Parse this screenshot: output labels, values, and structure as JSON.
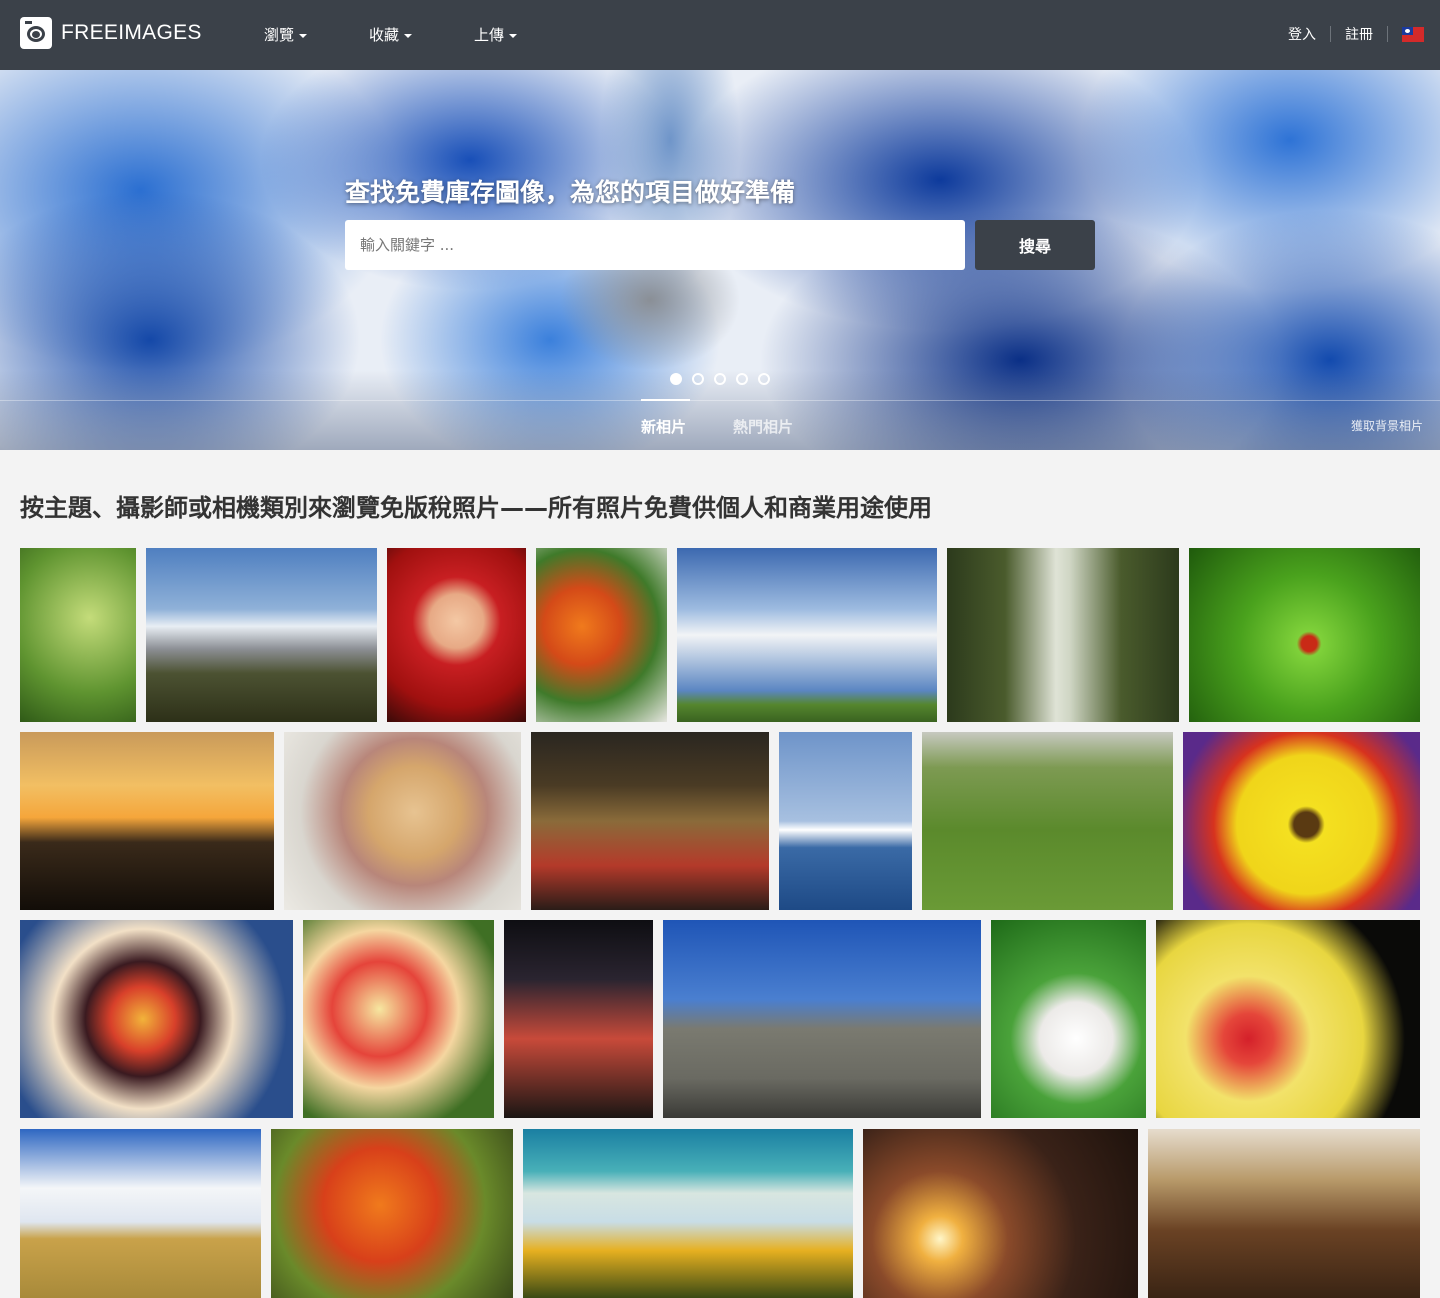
{
  "header": {
    "logo_text": "FREEIMAGES",
    "menus": [
      {
        "label": "瀏覽"
      },
      {
        "label": "收藏"
      },
      {
        "label": "上傳"
      }
    ],
    "login": "登入",
    "register": "註冊",
    "language_flag": "taiwan-flag-icon"
  },
  "hero": {
    "title": "查找免費庫存圖像，為您的項目做好準備",
    "search_placeholder": "輸入關鍵字 ...",
    "search_button": "搜尋",
    "carousel": {
      "total_slides": 5,
      "active_slide": 1
    },
    "tabs": [
      {
        "label": "新相片",
        "active": true
      },
      {
        "label": "熱門相片",
        "active": false
      }
    ],
    "background_credit": "獲取背景相片"
  },
  "main": {
    "heading": "按主題、攝影師或相機類別來瀏覽免版稅照片——所有照片免費供個人和商業用途使用"
  },
  "gallery": {
    "photos": [
      {
        "subject": "water-drop-on-leaf"
      },
      {
        "subject": "snow-capped-mountain"
      },
      {
        "subject": "baby-in-santa-hat"
      },
      {
        "subject": "garden-flowers"
      },
      {
        "subject": "clouds-over-field"
      },
      {
        "subject": "palm-tree-avenue"
      },
      {
        "subject": "ladybug-on-leaf"
      },
      {
        "subject": "sunset-tree-silhouettes"
      },
      {
        "subject": "golden-retriever-puppy"
      },
      {
        "subject": "city-street-night-traffic"
      },
      {
        "subject": "sailboat-at-sea"
      },
      {
        "subject": "children-playing-in-park"
      },
      {
        "subject": "yellow-gerbera-flower"
      },
      {
        "subject": "fruit-tarts"
      },
      {
        "subject": "red-yellow-tulips"
      },
      {
        "subject": "neon-city-night"
      },
      {
        "subject": "hillside-town"
      },
      {
        "subject": "bunny-in-santa-hat"
      },
      {
        "subject": "yellow-hibiscus"
      },
      {
        "subject": "clouds-over-wheat-field"
      },
      {
        "subject": "autumn-maple-leaves"
      },
      {
        "subject": "beach-with-sunflowers"
      },
      {
        "subject": "building-with-flag-at-sunset"
      },
      {
        "subject": "dining-room-table"
      }
    ]
  },
  "colors": {
    "topbar": "#3b4149",
    "page_background": "#f3f3f3",
    "heading_text": "#333333",
    "hero_blue": "#1f5fc0"
  }
}
